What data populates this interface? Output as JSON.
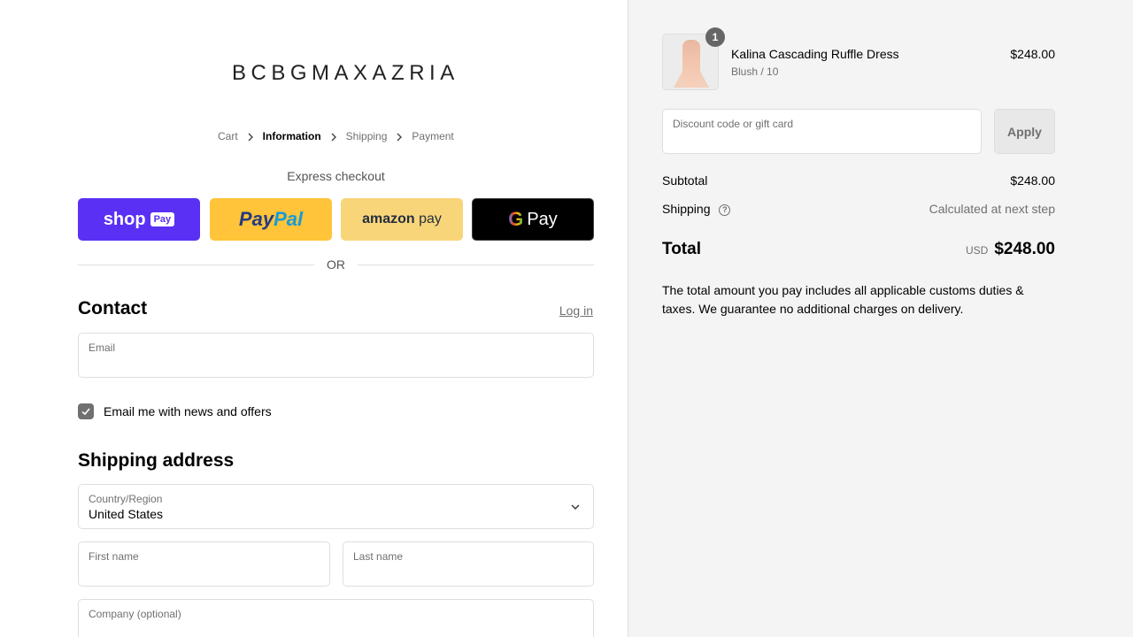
{
  "brand": {
    "logo": "BCBGMAXAZRIA"
  },
  "breadcrumb": [
    {
      "label": "Cart",
      "active": false
    },
    {
      "label": "Information",
      "active": true
    },
    {
      "label": "Shipping",
      "active": false
    },
    {
      "label": "Payment",
      "active": false
    }
  ],
  "express": {
    "title": "Express checkout",
    "shop": {
      "text": "shop",
      "chip": "Pay"
    },
    "paypal": {
      "part1": "Pay",
      "part2": "Pal"
    },
    "amazon": {
      "part1": "amazon",
      "part2": "pay"
    },
    "gpay": {
      "g": "G",
      "text": "Pay"
    },
    "or": "OR"
  },
  "contact": {
    "title": "Contact",
    "login": "Log in",
    "email_label": "Email",
    "email_value": "",
    "newsletter_label": "Email me with news and offers",
    "newsletter_checked": true
  },
  "shipping": {
    "title": "Shipping address",
    "country_label": "Country/Region",
    "country_value": "United States",
    "first_name_label": "First name",
    "last_name_label": "Last name",
    "company_label": "Company (optional)"
  },
  "summary": {
    "item": {
      "quantity": "1",
      "name": "Kalina Cascading Ruffle Dress",
      "variant": "Blush / 10",
      "price": "$248.00"
    },
    "discount_label": "Discount code or gift card",
    "apply_label": "Apply",
    "subtotal_label": "Subtotal",
    "subtotal_value": "$248.00",
    "shipping_label": "Shipping",
    "shipping_value": "Calculated at next step",
    "total_label": "Total",
    "currency": "USD",
    "total_value": "$248.00",
    "note": "The total amount you pay includes all applicable customs duties & taxes. We guarantee no additional charges on delivery."
  },
  "colors": {
    "shop_pay": "#5a31f4",
    "paypal": "#ffc439",
    "amazon_pay": "#f9d57a",
    "google_pay": "#000000",
    "sidebar_bg": "#f4f4f4"
  }
}
